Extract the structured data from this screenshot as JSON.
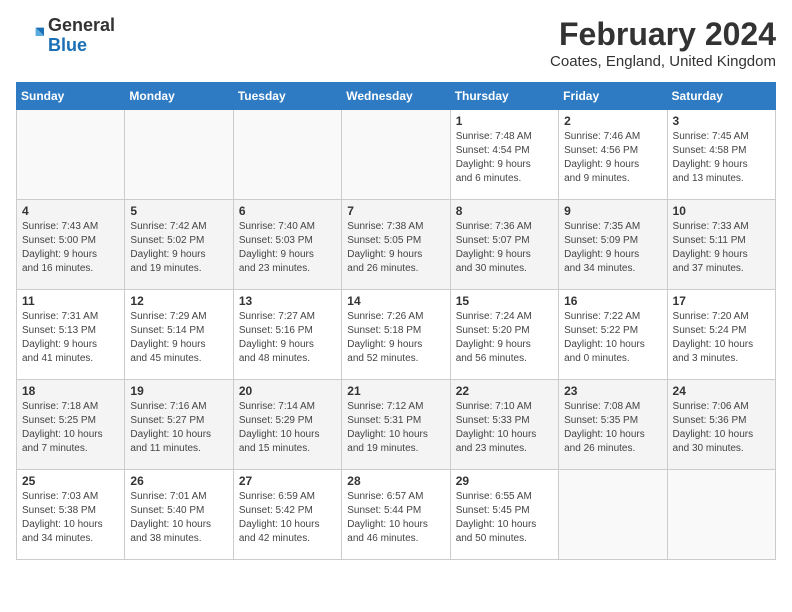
{
  "header": {
    "logo_general": "General",
    "logo_blue": "Blue",
    "month_title": "February 2024",
    "location": "Coates, England, United Kingdom"
  },
  "days_of_week": [
    "Sunday",
    "Monday",
    "Tuesday",
    "Wednesday",
    "Thursday",
    "Friday",
    "Saturday"
  ],
  "weeks": [
    [
      {
        "day": "",
        "info": ""
      },
      {
        "day": "",
        "info": ""
      },
      {
        "day": "",
        "info": ""
      },
      {
        "day": "",
        "info": ""
      },
      {
        "day": "1",
        "info": "Sunrise: 7:48 AM\nSunset: 4:54 PM\nDaylight: 9 hours\nand 6 minutes."
      },
      {
        "day": "2",
        "info": "Sunrise: 7:46 AM\nSunset: 4:56 PM\nDaylight: 9 hours\nand 9 minutes."
      },
      {
        "day": "3",
        "info": "Sunrise: 7:45 AM\nSunset: 4:58 PM\nDaylight: 9 hours\nand 13 minutes."
      }
    ],
    [
      {
        "day": "4",
        "info": "Sunrise: 7:43 AM\nSunset: 5:00 PM\nDaylight: 9 hours\nand 16 minutes."
      },
      {
        "day": "5",
        "info": "Sunrise: 7:42 AM\nSunset: 5:02 PM\nDaylight: 9 hours\nand 19 minutes."
      },
      {
        "day": "6",
        "info": "Sunrise: 7:40 AM\nSunset: 5:03 PM\nDaylight: 9 hours\nand 23 minutes."
      },
      {
        "day": "7",
        "info": "Sunrise: 7:38 AM\nSunset: 5:05 PM\nDaylight: 9 hours\nand 26 minutes."
      },
      {
        "day": "8",
        "info": "Sunrise: 7:36 AM\nSunset: 5:07 PM\nDaylight: 9 hours\nand 30 minutes."
      },
      {
        "day": "9",
        "info": "Sunrise: 7:35 AM\nSunset: 5:09 PM\nDaylight: 9 hours\nand 34 minutes."
      },
      {
        "day": "10",
        "info": "Sunrise: 7:33 AM\nSunset: 5:11 PM\nDaylight: 9 hours\nand 37 minutes."
      }
    ],
    [
      {
        "day": "11",
        "info": "Sunrise: 7:31 AM\nSunset: 5:13 PM\nDaylight: 9 hours\nand 41 minutes."
      },
      {
        "day": "12",
        "info": "Sunrise: 7:29 AM\nSunset: 5:14 PM\nDaylight: 9 hours\nand 45 minutes."
      },
      {
        "day": "13",
        "info": "Sunrise: 7:27 AM\nSunset: 5:16 PM\nDaylight: 9 hours\nand 48 minutes."
      },
      {
        "day": "14",
        "info": "Sunrise: 7:26 AM\nSunset: 5:18 PM\nDaylight: 9 hours\nand 52 minutes."
      },
      {
        "day": "15",
        "info": "Sunrise: 7:24 AM\nSunset: 5:20 PM\nDaylight: 9 hours\nand 56 minutes."
      },
      {
        "day": "16",
        "info": "Sunrise: 7:22 AM\nSunset: 5:22 PM\nDaylight: 10 hours\nand 0 minutes."
      },
      {
        "day": "17",
        "info": "Sunrise: 7:20 AM\nSunset: 5:24 PM\nDaylight: 10 hours\nand 3 minutes."
      }
    ],
    [
      {
        "day": "18",
        "info": "Sunrise: 7:18 AM\nSunset: 5:25 PM\nDaylight: 10 hours\nand 7 minutes."
      },
      {
        "day": "19",
        "info": "Sunrise: 7:16 AM\nSunset: 5:27 PM\nDaylight: 10 hours\nand 11 minutes."
      },
      {
        "day": "20",
        "info": "Sunrise: 7:14 AM\nSunset: 5:29 PM\nDaylight: 10 hours\nand 15 minutes."
      },
      {
        "day": "21",
        "info": "Sunrise: 7:12 AM\nSunset: 5:31 PM\nDaylight: 10 hours\nand 19 minutes."
      },
      {
        "day": "22",
        "info": "Sunrise: 7:10 AM\nSunset: 5:33 PM\nDaylight: 10 hours\nand 23 minutes."
      },
      {
        "day": "23",
        "info": "Sunrise: 7:08 AM\nSunset: 5:35 PM\nDaylight: 10 hours\nand 26 minutes."
      },
      {
        "day": "24",
        "info": "Sunrise: 7:06 AM\nSunset: 5:36 PM\nDaylight: 10 hours\nand 30 minutes."
      }
    ],
    [
      {
        "day": "25",
        "info": "Sunrise: 7:03 AM\nSunset: 5:38 PM\nDaylight: 10 hours\nand 34 minutes."
      },
      {
        "day": "26",
        "info": "Sunrise: 7:01 AM\nSunset: 5:40 PM\nDaylight: 10 hours\nand 38 minutes."
      },
      {
        "day": "27",
        "info": "Sunrise: 6:59 AM\nSunset: 5:42 PM\nDaylight: 10 hours\nand 42 minutes."
      },
      {
        "day": "28",
        "info": "Sunrise: 6:57 AM\nSunset: 5:44 PM\nDaylight: 10 hours\nand 46 minutes."
      },
      {
        "day": "29",
        "info": "Sunrise: 6:55 AM\nSunset: 5:45 PM\nDaylight: 10 hours\nand 50 minutes."
      },
      {
        "day": "",
        "info": ""
      },
      {
        "day": "",
        "info": ""
      }
    ]
  ]
}
